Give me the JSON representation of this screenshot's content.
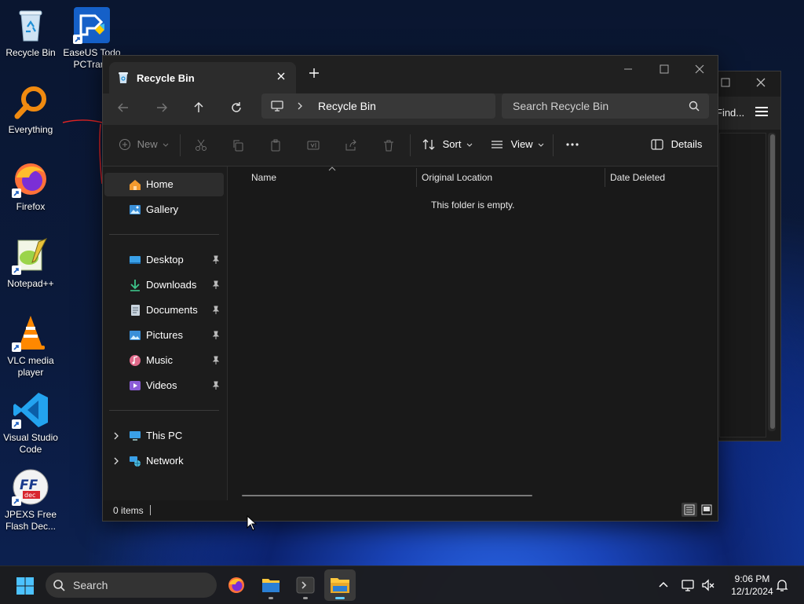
{
  "desktop": {
    "icons": [
      {
        "label": "Recycle Bin",
        "icon": "recycle-bin-icon"
      },
      {
        "label": "EaseUS Todo PCTrans",
        "icon": "easeus-icon"
      },
      {
        "label": "Everything",
        "icon": "everything-icon"
      },
      {
        "label": "Firefox",
        "icon": "firefox-icon"
      },
      {
        "label": "Notepad++",
        "icon": "notepad-plus-plus-icon"
      },
      {
        "label": "VLC media player",
        "icon": "vlc-icon"
      },
      {
        "label": "Visual Studio Code",
        "icon": "vscode-icon"
      },
      {
        "label": "JPEXS Free Flash Dec...",
        "icon": "jpexs-icon"
      }
    ]
  },
  "back_window": {
    "find_label": "Find..."
  },
  "explorer": {
    "tab_title": "Recycle Bin",
    "address": {
      "location": "Recycle Bin"
    },
    "search": {
      "placeholder": "Search Recycle Bin"
    },
    "toolbar": {
      "new_label": "New",
      "sort_label": "Sort",
      "view_label": "View",
      "more_label": "...",
      "details_label": "Details"
    },
    "nav": {
      "home": "Home",
      "gallery": "Gallery",
      "quick_access": [
        {
          "label": "Desktop",
          "icon": "desktop-folder-icon"
        },
        {
          "label": "Downloads",
          "icon": "downloads-icon"
        },
        {
          "label": "Documents",
          "icon": "documents-icon"
        },
        {
          "label": "Pictures",
          "icon": "pictures-icon"
        },
        {
          "label": "Music",
          "icon": "music-icon"
        },
        {
          "label": "Videos",
          "icon": "videos-icon"
        }
      ],
      "this_pc": "This PC",
      "network": "Network"
    },
    "columns": {
      "name": "Name",
      "original_location": "Original Location",
      "date_deleted": "Date Deleted"
    },
    "empty_message": "This folder is empty.",
    "status": {
      "item_count": "0 items"
    }
  },
  "taskbar": {
    "search_placeholder": "Search",
    "apps": [
      {
        "name": "firefox",
        "icon": "firefox-icon"
      },
      {
        "name": "file-explorer",
        "icon": "file-explorer-icon"
      },
      {
        "name": "terminal",
        "icon": "terminal-icon"
      },
      {
        "name": "file-explorer-active",
        "icon": "file-explorer-icon"
      }
    ],
    "clock": {
      "time": "9:06 PM",
      "date": "12/1/2024"
    }
  },
  "colors": {
    "accent": "#60cdff",
    "window_bg": "#191919",
    "titlebar_bg": "#202020"
  }
}
